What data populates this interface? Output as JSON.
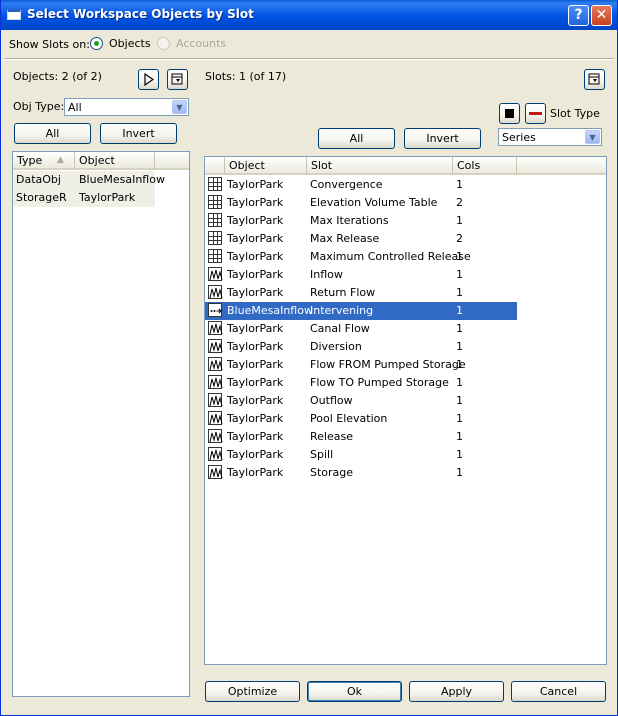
{
  "window": {
    "title": "Select Workspace Objects by Slot"
  },
  "show_slots": {
    "label": "Show Slots on:",
    "options": [
      {
        "label": "Objects",
        "checked": true,
        "disabled": false
      },
      {
        "label": "Accounts",
        "checked": false,
        "disabled": true
      }
    ]
  },
  "objects_panel": {
    "count_label": "Objects: 2 (of 2)",
    "obj_type_label": "Obj Type:",
    "obj_type_value": "All",
    "all_button": "All",
    "invert_button": "Invert",
    "columns": [
      "Type",
      "Object"
    ],
    "rows": [
      {
        "type": "DataObj",
        "object": "BlueMesaInflow"
      },
      {
        "type": "StorageR",
        "object": "TaylorPark"
      }
    ]
  },
  "slots_panel": {
    "count_label": "Slots: 1 (of 17)",
    "slot_type_label": "Slot Type",
    "slot_type_value": "Series",
    "all_button": "All",
    "invert_button": "Invert",
    "columns": [
      "Object",
      "Slot",
      "Cols"
    ],
    "rows": [
      {
        "icon": "table-slot-icon",
        "object": "TaylorPark",
        "slot": "Convergence",
        "cols": "1"
      },
      {
        "icon": "table-slot-icon",
        "object": "TaylorPark",
        "slot": "Elevation Volume Table",
        "cols": "2"
      },
      {
        "icon": "table-slot-icon",
        "object": "TaylorPark",
        "slot": "Max Iterations",
        "cols": "1"
      },
      {
        "icon": "table-slot-icon",
        "object": "TaylorPark",
        "slot": "Max Release",
        "cols": "2"
      },
      {
        "icon": "table-slot-icon",
        "object": "TaylorPark",
        "slot": "Maximum Controlled Release",
        "cols": "1"
      },
      {
        "icon": "series-slot-icon",
        "object": "TaylorPark",
        "slot": "Inflow",
        "cols": "1"
      },
      {
        "icon": "series-slot-icon",
        "object": "TaylorPark",
        "slot": "Return Flow",
        "cols": "1"
      },
      {
        "icon": "data-series-slot-icon",
        "object": "BlueMesaInflow",
        "slot": "Intervening",
        "cols": "1",
        "selected": true
      },
      {
        "icon": "series-slot-icon",
        "object": "TaylorPark",
        "slot": "Canal Flow",
        "cols": "1"
      },
      {
        "icon": "series-slot-icon",
        "object": "TaylorPark",
        "slot": "Diversion",
        "cols": "1"
      },
      {
        "icon": "series-slot-icon",
        "object": "TaylorPark",
        "slot": "Flow FROM Pumped Storage",
        "cols": "1"
      },
      {
        "icon": "series-slot-icon",
        "object": "TaylorPark",
        "slot": "Flow TO Pumped Storage",
        "cols": "1"
      },
      {
        "icon": "series-slot-icon",
        "object": "TaylorPark",
        "slot": "Outflow",
        "cols": "1"
      },
      {
        "icon": "series-slot-icon",
        "object": "TaylorPark",
        "slot": "Pool Elevation",
        "cols": "1"
      },
      {
        "icon": "series-slot-icon",
        "object": "TaylorPark",
        "slot": "Release",
        "cols": "1"
      },
      {
        "icon": "series-slot-icon",
        "object": "TaylorPark",
        "slot": "Spill",
        "cols": "1"
      },
      {
        "icon": "series-slot-icon",
        "object": "TaylorPark",
        "slot": "Storage",
        "cols": "1"
      }
    ]
  },
  "footer": {
    "optimize": "Optimize",
    "ok": "Ok",
    "apply": "Apply",
    "cancel": "Cancel"
  },
  "colors": {
    "titlebar": "#0054e3",
    "selection": "#316ac5",
    "radio_checked": "#21a121"
  }
}
